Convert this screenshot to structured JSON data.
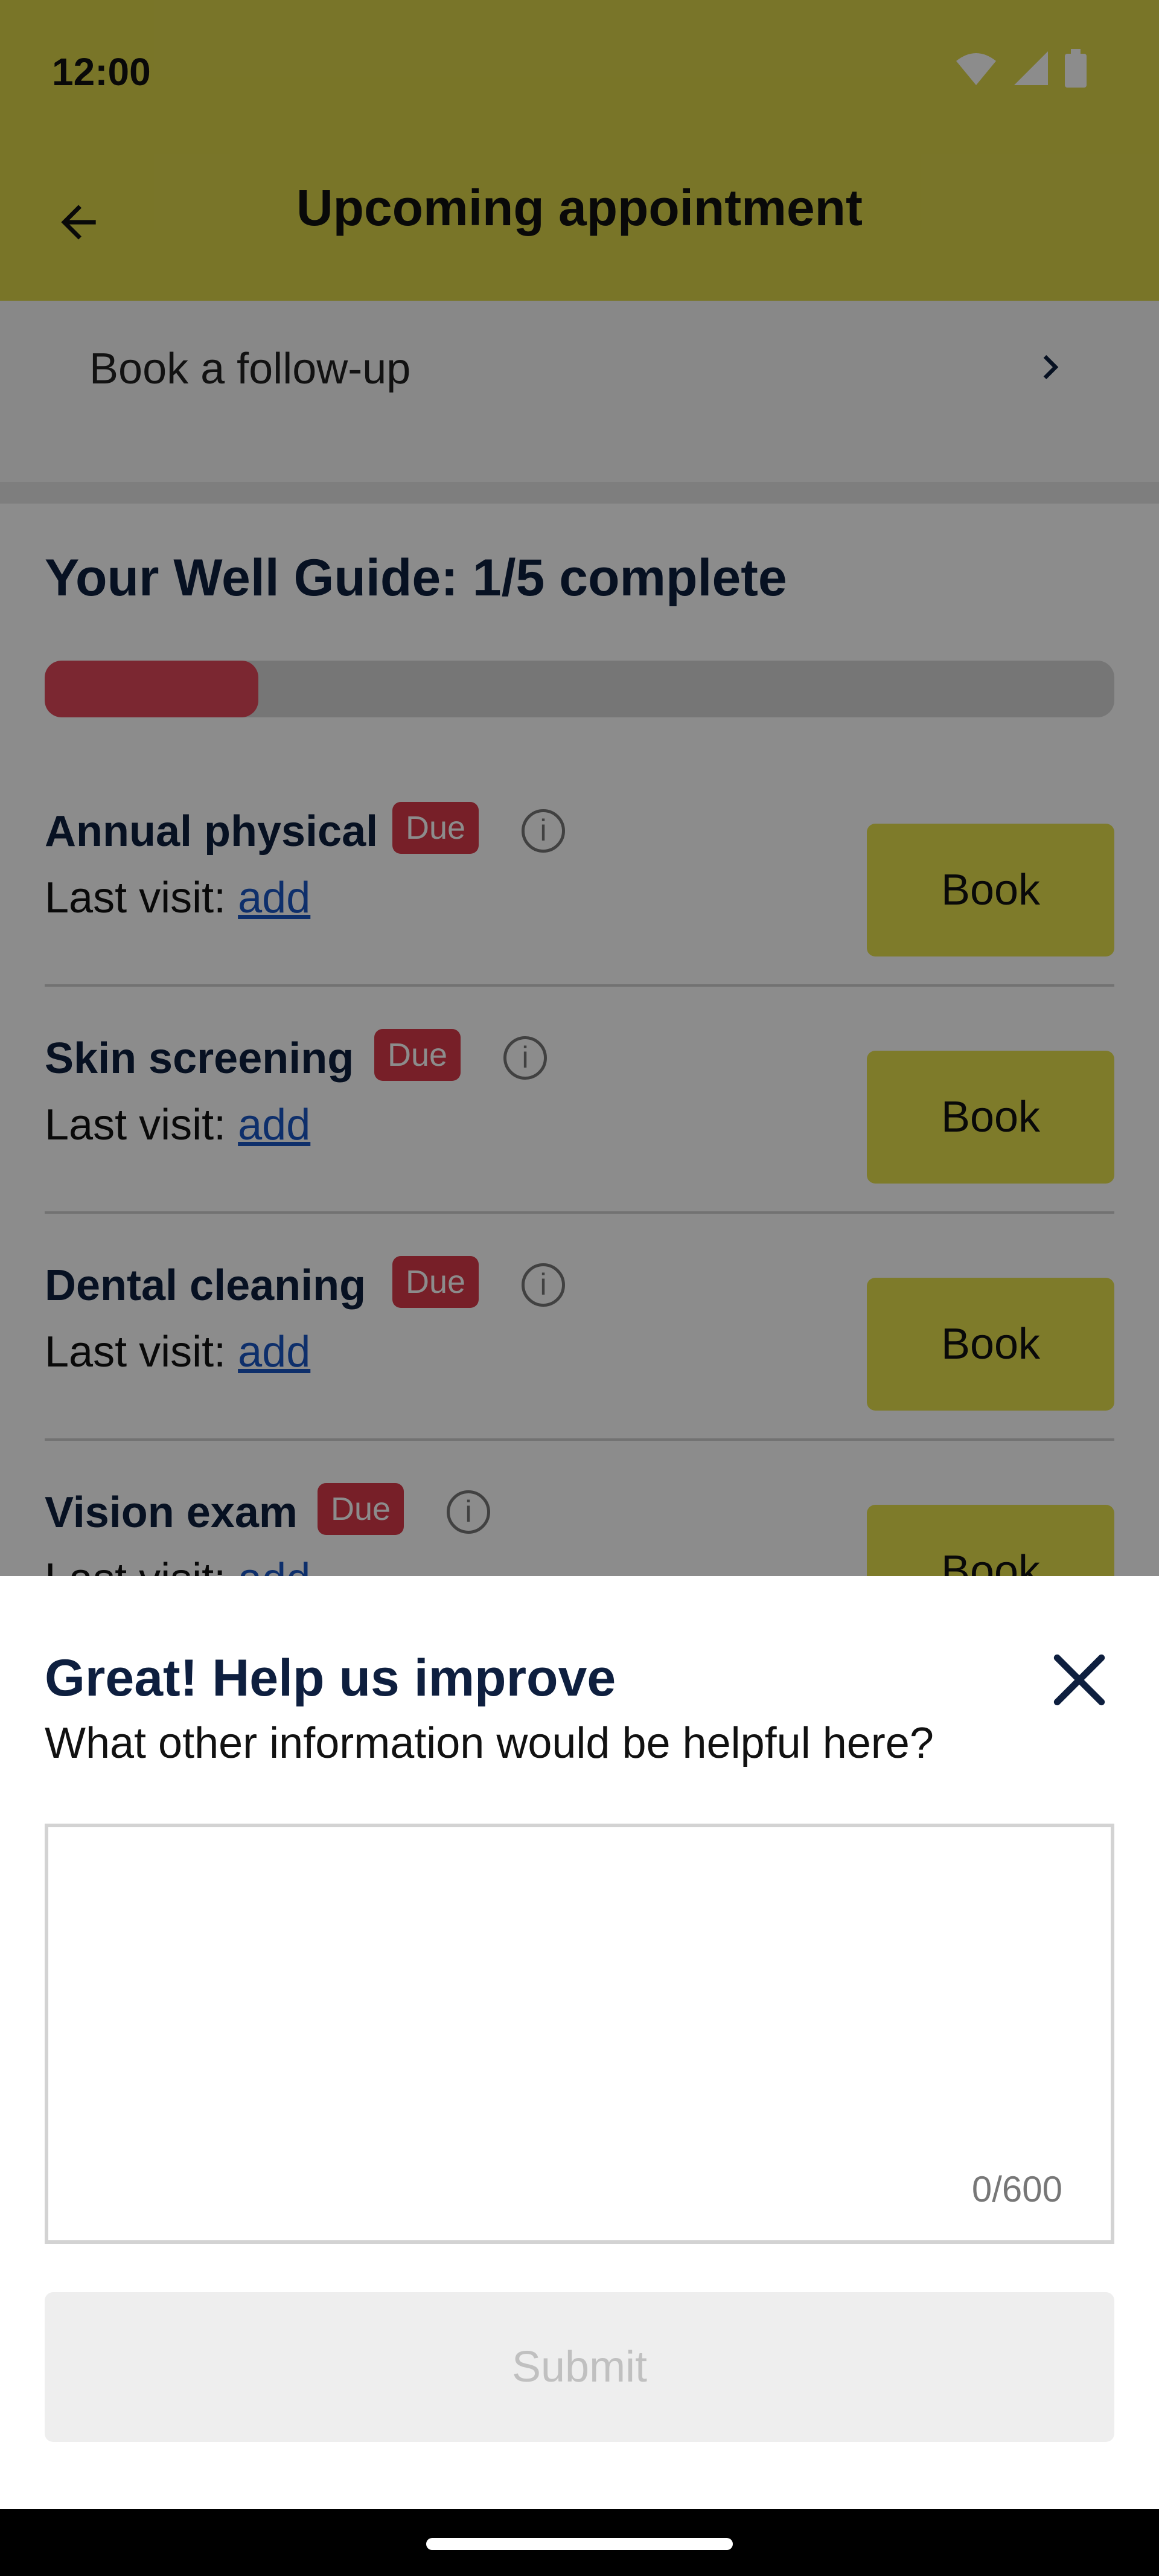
{
  "status_bar": {
    "time": "12:00",
    "icons": [
      "wifi-icon",
      "signal-icon",
      "battery-icon"
    ]
  },
  "app_bar": {
    "title": "Upcoming appointment",
    "back_icon": "arrow-left-icon"
  },
  "follow_up": {
    "label": "Book a follow-up",
    "chevron_icon": "chevron-right-icon"
  },
  "well_guide": {
    "title": "Your Well Guide: 1/5 complete",
    "progress_fraction": 0.2,
    "items": [
      {
        "title": "Annual physical",
        "badge": "Due",
        "last_visit_label": "Last visit:",
        "last_visit_link": "add",
        "book_label": "Book"
      },
      {
        "title": "Skin screening",
        "badge": "Due",
        "last_visit_label": "Last visit:",
        "last_visit_link": "add",
        "book_label": "Book"
      },
      {
        "title": "Dental cleaning",
        "badge": "Due",
        "last_visit_label": "Last visit:",
        "last_visit_link": "add",
        "book_label": "Book"
      },
      {
        "title": "Vision exam",
        "badge": "Due",
        "last_visit_label": "Last visit:",
        "last_visit_link": "add",
        "book_label": "Book"
      }
    ]
  },
  "sheet": {
    "title": "Great! Help us improve",
    "subtitle": "What other information would be helpful here?",
    "input_value": "",
    "counter": "0/600",
    "submit_label": "Submit",
    "close_icon": "close-icon"
  },
  "colors": {
    "header_bg": "#DCD54A",
    "badge_bg": "#D93A49",
    "progress_fill": "#E0485A",
    "book_bg": "#E6E04E",
    "link": "#1A56C4",
    "heading": "#0E1F3F"
  }
}
